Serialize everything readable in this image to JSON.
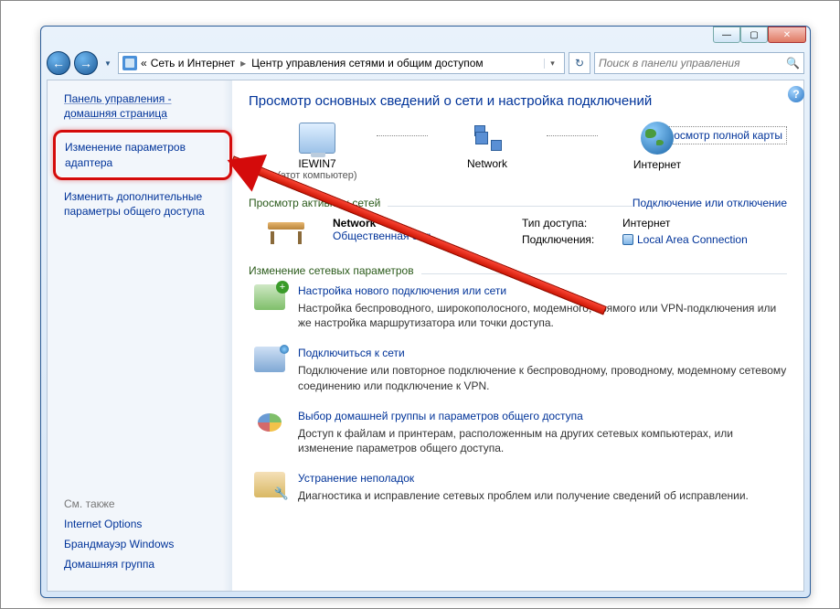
{
  "breadcrumb": {
    "prefix": "«",
    "seg1": "Сеть и Интернет",
    "seg2": "Центр управления сетями и общим доступом"
  },
  "search": {
    "placeholder": "Поиск в панели управления"
  },
  "sidebar": {
    "heading": "Панель управления - домашняя страница",
    "item_adapter": "Изменение параметров адаптера",
    "item_sharing": "Изменить дополнительные параметры общего доступа",
    "see_also": "См. также",
    "see1": "Internet Options",
    "see2": "Брандмауэр Windows",
    "see3": "Домашняя группа"
  },
  "main": {
    "title": "Просмотр основных сведений о сети и настройка подключений",
    "full_map": "Просмотр полной карты",
    "topo": {
      "pc_name": "IEWIN7",
      "pc_sub": "(этот компьютер)",
      "net_name": "Network",
      "inet_name": "Интернет"
    },
    "active_head": "Просмотр активных сетей",
    "active_link": "Подключение или отключение",
    "network": {
      "name": "Network",
      "type": "Общественная сеть",
      "access_k": "Тип доступа:",
      "access_v": "Интернет",
      "conn_k": "Подключения:",
      "conn_v": "Local Area Connection"
    },
    "change_head": "Изменение сетевых параметров",
    "items": [
      {
        "title": "Настройка нового подключения или сети",
        "desc": "Настройка беспроводного, широкополосного, модемного, прямого или VPN-подключения или же настройка маршрутизатора или точки доступа."
      },
      {
        "title": "Подключиться к сети",
        "desc": "Подключение или повторное подключение к беспроводному, проводному, модемному сетевому соединению или подключение к VPN."
      },
      {
        "title": "Выбор домашней группы и параметров общего доступа",
        "desc": "Доступ к файлам и принтерам, расположенным на других сетевых компьютерах, или изменение параметров общего доступа."
      },
      {
        "title": "Устранение неполадок",
        "desc": "Диагностика и исправление сетевых проблем или получение сведений об исправлении."
      }
    ]
  }
}
